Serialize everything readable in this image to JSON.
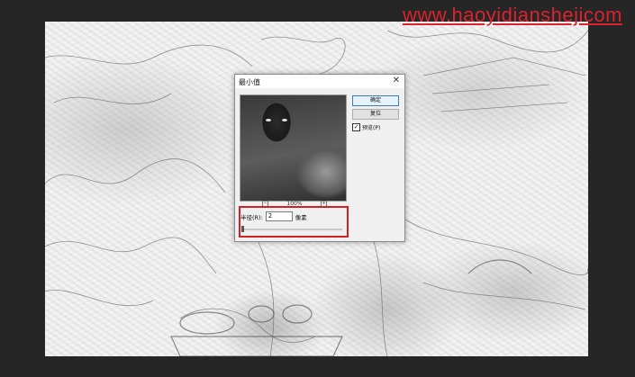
{
  "watermark": "www.haoyidianshejicom",
  "dialog": {
    "title": "最小值",
    "ok_label": "确定",
    "reset_label": "复位",
    "preview_label": "预览(P)",
    "preview_checked": "✓",
    "zoom_minus": "−",
    "zoom_plus": "+",
    "zoom_level": "100%",
    "radius_label": "半径(R):",
    "radius_value": "2",
    "radius_unit": "像素"
  }
}
